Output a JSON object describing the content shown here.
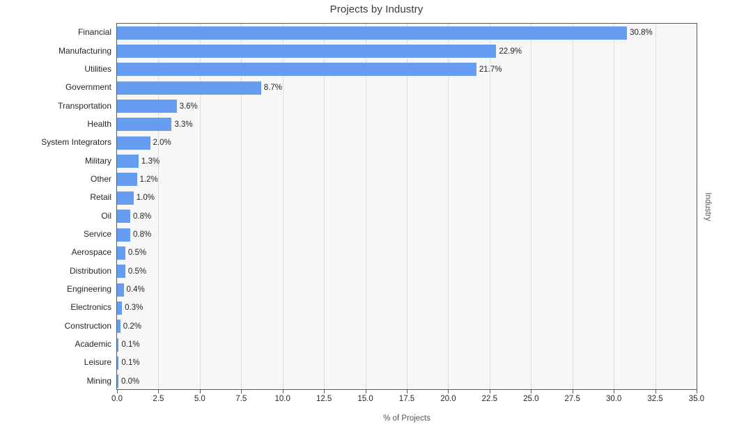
{
  "chart_data": {
    "type": "bar",
    "orientation": "horizontal",
    "title": "Projects by Industry",
    "xlabel": "% of Projects",
    "ylabel": "Industry",
    "xlim": [
      0.0,
      35.0
    ],
    "xticks": [
      "0.0",
      "2.5",
      "5.0",
      "7.5",
      "10.0",
      "12.5",
      "15.0",
      "17.5",
      "20.0",
      "22.5",
      "25.0",
      "27.5",
      "30.0",
      "32.5",
      "35.0"
    ],
    "xtick_values": [
      0.0,
      2.5,
      5.0,
      7.5,
      10.0,
      12.5,
      15.0,
      17.5,
      20.0,
      22.5,
      25.0,
      27.5,
      30.0,
      32.5,
      35.0
    ],
    "grid": "vertical-dotted",
    "legend": "none",
    "bar_color": "#669df0",
    "plot_background": "#f7f7f7",
    "categories": [
      "Financial",
      "Manufacturing",
      "Utilities",
      "Government",
      "Transportation",
      "Health",
      "System Integrators",
      "Military",
      "Other",
      "Retail",
      "Oil",
      "Service",
      "Aerospace",
      "Distribution",
      "Engineering",
      "Electronics",
      "Construction",
      "Academic",
      "Leisure",
      "Mining"
    ],
    "values": [
      30.8,
      22.9,
      21.7,
      8.7,
      3.6,
      3.3,
      2.0,
      1.3,
      1.2,
      1.0,
      0.8,
      0.8,
      0.5,
      0.5,
      0.4,
      0.3,
      0.2,
      0.1,
      0.1,
      0.0
    ],
    "value_labels": [
      "30.8%",
      "22.9%",
      "21.7%",
      "8.7%",
      "3.6%",
      "3.3%",
      "2.0%",
      "1.3%",
      "1.2%",
      "1.0%",
      "0.8%",
      "0.8%",
      "0.5%",
      "0.5%",
      "0.4%",
      "0.3%",
      "0.2%",
      "0.1%",
      "0.1%",
      "0.0%"
    ]
  }
}
